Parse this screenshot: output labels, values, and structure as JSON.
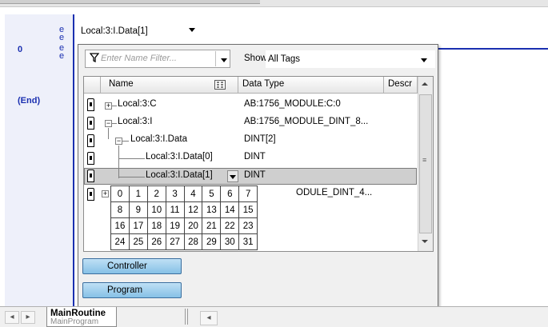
{
  "ladder": {
    "rung_number": "0",
    "rung_markers": [
      "e",
      "e",
      "e",
      "e"
    ],
    "end_label": "(End)"
  },
  "tag_combo": {
    "value": "Local:3:I.Data[1]"
  },
  "filter": {
    "placeholder": "Enter Name Filter..."
  },
  "show": {
    "label": "Show:",
    "value": "All Tags"
  },
  "table": {
    "headers": {
      "name": "Name",
      "data_type": "Data Type",
      "description": "Descr"
    },
    "rows": [
      {
        "name": "Local:3:C",
        "data_type": "AB:1756_MODULE:C:0",
        "expander": "+"
      },
      {
        "name": "Local:3:I",
        "data_type": "AB:1756_MODULE_DINT_8...",
        "expander": "−"
      },
      {
        "name": "Local:3:I.Data",
        "data_type": "DINT[2]",
        "expander": "−"
      },
      {
        "name": "Local:3:I.Data[0]",
        "data_type": "DINT",
        "expander": ""
      },
      {
        "name": "Local:3:I.Data[1]",
        "data_type": "DINT",
        "expander": ""
      },
      {
        "name": "",
        "data_type": "ODULE_DINT_4...",
        "expander": "+"
      }
    ]
  },
  "bit_grid": [
    [
      "0",
      "1",
      "2",
      "3",
      "4",
      "5",
      "6",
      "7"
    ],
    [
      "8",
      "9",
      "10",
      "11",
      "12",
      "13",
      "14",
      "15"
    ],
    [
      "16",
      "17",
      "18",
      "19",
      "20",
      "21",
      "22",
      "23"
    ],
    [
      "24",
      "25",
      "26",
      "27",
      "28",
      "29",
      "30",
      "31"
    ]
  ],
  "buttons": {
    "controller": "Controller",
    "program": "Program"
  },
  "bottom_tab": {
    "title": "MainRoutine",
    "subtitle": "MainProgram"
  },
  "icons": {
    "filter": "filter-icon",
    "tag": "tag-icon",
    "column_chooser": "column-chooser-icon",
    "dropdown": "chevron-down-icon"
  }
}
